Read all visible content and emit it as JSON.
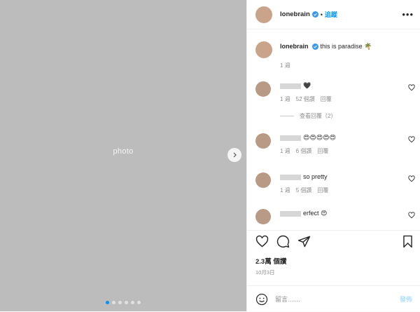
{
  "media": {
    "placeholder": "photo"
  },
  "header": {
    "username": "lonebrain",
    "separator": "•",
    "follow_label": "追蹤",
    "more_label": "•••"
  },
  "caption": {
    "username": "lonebrain",
    "text": "this is paradise 🌴",
    "time": "1 週"
  },
  "comments": [
    {
      "text": "🖤",
      "time": "1 週",
      "likes": "52 個讚",
      "reply": "回覆",
      "view_replies": "查看回覆（2）"
    },
    {
      "text": "😍😍😍😍😍",
      "time": "1 週",
      "likes": "6 個讚",
      "reply": "回覆"
    },
    {
      "text": "so pretty",
      "time": "1 週",
      "likes": "5 個讚",
      "reply": "回覆"
    },
    {
      "text": "erfect 😍"
    }
  ],
  "footer": {
    "likes": "2.3萬 個讚",
    "date": "10月3日",
    "comment_placeholder": "留言……",
    "post_label": "發佈"
  },
  "colors": {
    "accent": "#0095f6",
    "verified": "#3897f0"
  }
}
